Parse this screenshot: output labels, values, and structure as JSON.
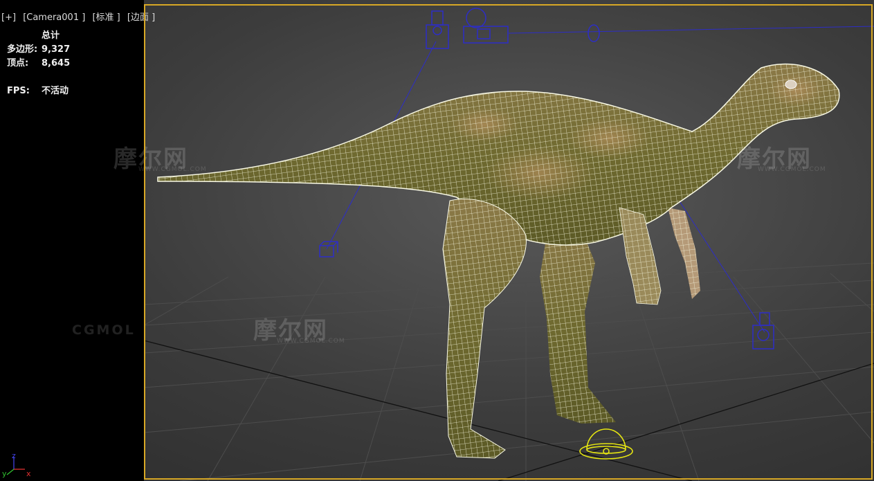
{
  "viewport": {
    "labels": [
      "[+]",
      "[Camera001 ]",
      "[标准 ]",
      "[边面 ]"
    ],
    "accent_color": "#d8a825"
  },
  "stats": {
    "header": "总计",
    "polygons_label": "多边形:",
    "polygons_value": "9,327",
    "vertices_label": "顶点:",
    "vertices_value": "8,645",
    "fps_label": "FPS:",
    "fps_value": "不活动"
  },
  "watermarks": {
    "brand": "摩尔网",
    "url": "WWW.CGMOL.COM",
    "logo": "CGMOL"
  },
  "axis": {
    "z": "z",
    "y": "y",
    "x": "x"
  },
  "scene": {
    "object": "dinosaur-wireframe-mesh",
    "camera_color": "#2d2dc8",
    "light_color": "#e6e612"
  }
}
